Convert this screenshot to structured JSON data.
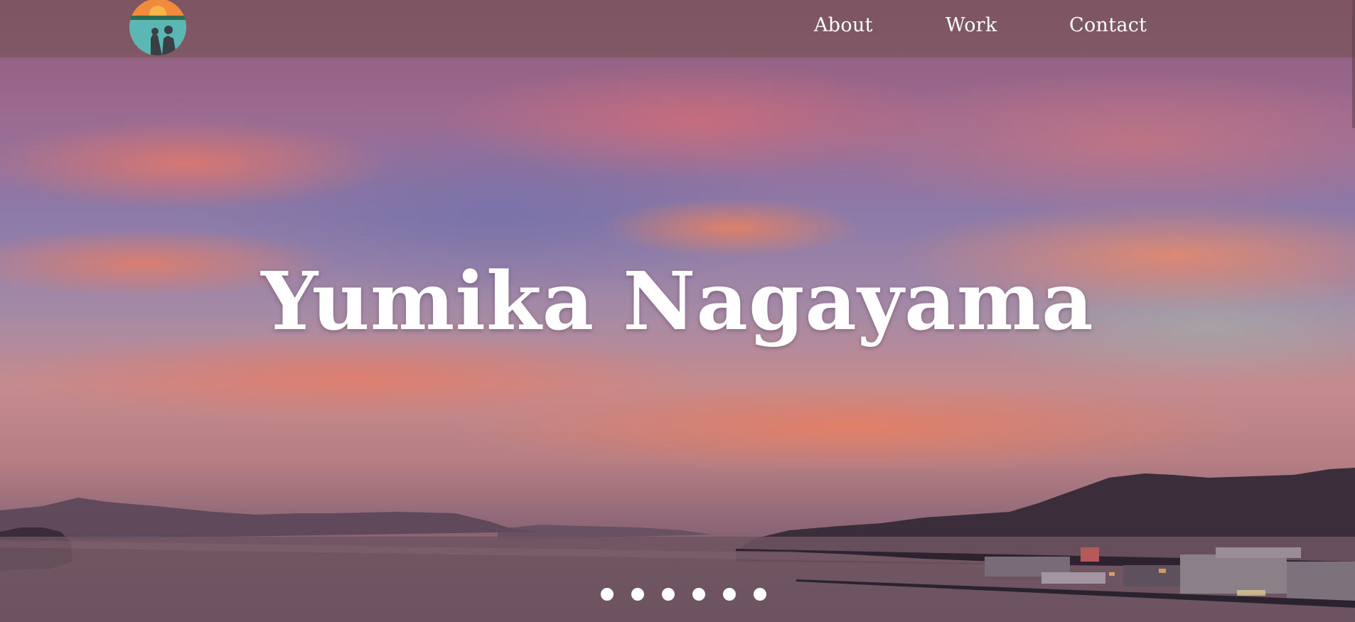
{
  "site": {
    "owner_name": "Yumika Nagayama"
  },
  "header": {
    "logo_icon": "sunset-silhouette-logo-icon",
    "nav": [
      {
        "label": "About"
      },
      {
        "label": "Work"
      },
      {
        "label": "Contact"
      }
    ]
  },
  "hero": {
    "title": "Yumika Nagayama",
    "background_image": "sunset over sea and islands photo",
    "slide_count": 6
  },
  "colors": {
    "header_bg": "#78555a",
    "text": "#ffffff",
    "dot": "#ffffff"
  }
}
